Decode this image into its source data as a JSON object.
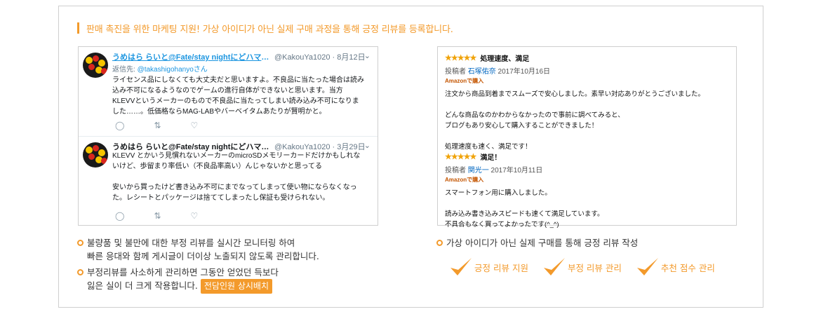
{
  "headline": "판매 촉진을 위한 마케팅 지원! 가상 아이디가 아닌 실제 구매 과정을 통해 긍정 리뷰를 등록합니다.",
  "tweets": [
    {
      "name": "うめはら らいと@Fate/stay nightにどハマり...",
      "handle": "@KakouYa1020 · 8月12日",
      "reply_prefix": "返信先: ",
      "reply_handle": "@takashigohanyoさん",
      "body": "ライセンス品にしなくても大丈夫だと思いますよ。不良品に当たった場合は読み\n込み不可になるようなのでゲームの進行自体ができないと思います。当方\nKLEVVというメーカーのもので不良品に当たってしまい読み込み不可になりま\nした……。低価格ならMAG-LABやバーベイタムあたりが賢明かと。"
    },
    {
      "name": "うめはら らいと@Fate/stay nightにどハマり...",
      "handle": "@KakouYa1020 · 3月29日",
      "body": "KLEVV とかいう見慣れないメーカーのmicroSDメモリーカードだけかもしれな\nいけど、歩留まり率低い（不良品率高い）んじゃないかと思ってる\n\n安いから買ったけど書き込み不可にまでなってしまって使い物にならなくなっ\nた。レシートとパッケージは捨ててしまったし保証も受けられない。"
    }
  ],
  "tweet_icons": {
    "reply": "reply-icon",
    "retweet": "retweet-icon",
    "like": "heart-icon"
  },
  "reviews": [
    {
      "stars": "★★★★★",
      "title": "処理速度、満足",
      "meta_prefix": "投稿者 ",
      "author": "石塚佑奈",
      "date": " 2017年10月16日",
      "badge": "Amazonで購入",
      "body": "注文から商品到着までスムーズで安心しました。素早い対応ありがとうございました。\n\nどんな商品なのかわからなかったので事前に調べてみると、\nブログもあり安心して購入することができました！\n\n処理速度も速く、満足です！"
    },
    {
      "stars": "★★★★★",
      "title": "満足！",
      "meta_prefix": "投稿者 ",
      "author": "関光一",
      "date": " 2017年10月11日",
      "badge": "Amazonで購入",
      "body": "スマートフォン用に購入しました。\n\n読み込み書き込みスピードも速くて満足しています。\n不具合もなく買ってよかったです(^_^)"
    }
  ],
  "left_bullets": [
    {
      "text": "불량품 및 불만에 대한 부정 리뷰를 실시간 모니터링 하여\n빠른 응대와 함께 게시글이 더이상 노출되지 않도록 관리합니다."
    },
    {
      "text": "부정리뷰를 사소하게 관리하면 그동안 얻었던 득보다\n잃은 실이 더 크게 작용합니다.",
      "badge": "전담인원 상시배치"
    }
  ],
  "right_bullet": "가상 아이디가 아닌 실제 구매를 통해 긍정 리뷰 작성",
  "checks": [
    "긍정 리뷰 지원",
    "부정 리뷰 관리",
    "추천 점수 관리"
  ],
  "colors": {
    "accent": "#f39a2b",
    "twitter_blue": "#1b95e0",
    "amazon_badge": "#c45500",
    "star": "#f0a30a"
  }
}
